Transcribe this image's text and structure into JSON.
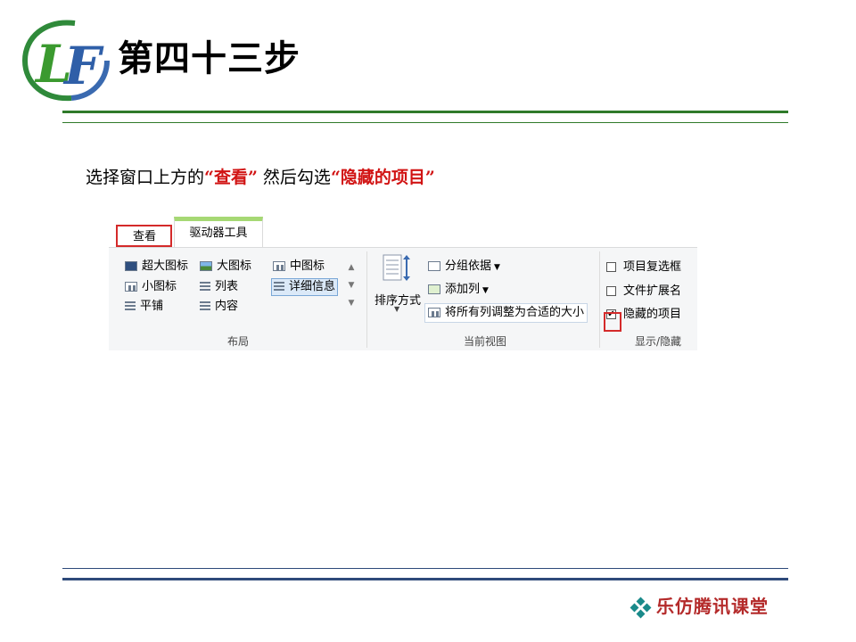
{
  "slide": {
    "title": "第四十三步",
    "instruction": {
      "prefix": "选择窗口上方的",
      "highlight1": "“查看”",
      "middle": "然后勾选",
      "highlight2": "“隐藏的项目”"
    },
    "brand": "乐仿腾讯课堂",
    "logo_text": "LF"
  },
  "ribbon": {
    "tabs": {
      "view": "查看",
      "drive_tools": "驱动器工具"
    },
    "layout": {
      "label": "布局",
      "items": {
        "extra_large": "超大图标",
        "large": "大图标",
        "medium": "中图标",
        "small": "小图标",
        "list": "列表",
        "details": "详细信息",
        "tiles": "平铺",
        "content": "内容"
      }
    },
    "current_view": {
      "label": "当前视图",
      "sort": "排序方式",
      "group_by": "分组依据",
      "add_columns": "添加列",
      "size_all_columns": "将所有列调整为合适的大小"
    },
    "show_hide": {
      "label": "显示/隐藏",
      "item_checkboxes": "项目复选框",
      "file_extensions": "文件扩展名",
      "hidden_items": "隐藏的项目"
    }
  },
  "colors": {
    "highlight": "#d11414",
    "green_rule": "#2f7a2a",
    "blue_rule": "#2e4a7a",
    "brand": "#b42a2a"
  }
}
